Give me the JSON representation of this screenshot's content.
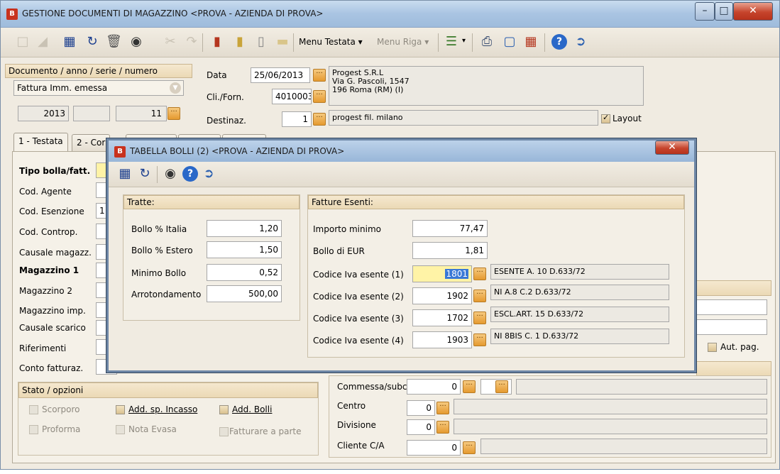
{
  "window": {
    "title": "GESTIONE DOCUMENTI DI MAGAZZINO <PROVA - AZIENDA DI PROVA>",
    "app_icon": "B"
  },
  "menus": {
    "testata": "Menu Testata",
    "riga": "Menu Riga"
  },
  "header": {
    "doc_group_label": "Documento / anno / serie / numero",
    "doc_type": "Fattura Imm. emessa",
    "year": "2013",
    "series": "",
    "number": "11",
    "data_label": "Data",
    "data_value": "25/06/2013",
    "cli_label": "Cli./Forn.",
    "cli_value": "4010003",
    "cli_address_1": "Progest S.R.L",
    "cli_address_2": "Via G. Pascoli, 1547",
    "cli_address_3": "196 Roma (RM)  (I)",
    "dest_label": "Destinaz.",
    "dest_value": "1",
    "dest_desc": "progest fil. milano",
    "layout_label": "Layout"
  },
  "tabs": {
    "tab1": "1 - Testata",
    "tab2": "2 - Cor"
  },
  "left_labels": {
    "tipo_bolla": "Tipo bolla/fatt.",
    "cod_agente": "Cod. Agente",
    "cod_esenzione": "Cod. Esenzione",
    "cod_esenzione_val": "1",
    "cod_controp": "Cod. Controp.",
    "causale_magazz": "Causale magazz.",
    "magazzino1": "Magazzino 1",
    "magazzino2": "Magazzino 2",
    "magazzino_imp": "Magazzino imp.",
    "causale_scarico": "Causale scarico",
    "riferimenti": "Riferimenti",
    "conto_fatturaz": "Conto fatturaz."
  },
  "stato": {
    "header": "Stato / opzioni",
    "scorporo": "Scorporo",
    "add_incasso": "Add. sp. Incasso",
    "add_bolli": "Add. Bolli",
    "proforma": "Proforma",
    "nota_evasa": "Nota Evasa",
    "fatturare_parte": "Fatturare a parte"
  },
  "bottom_right": {
    "aut_pag": "Aut. pag.",
    "commessa_label": "Commessa/subc.",
    "commessa_val": "0",
    "centro_label": "Centro",
    "centro_val": "0",
    "divisione_label": "Divisione",
    "divisione_val": "0",
    "cliente_ca_label": "Cliente C/A",
    "cliente_ca_val": "0"
  },
  "dialog": {
    "title": "TABELLA BOLLI (2) <PROVA - AZIENDA DI PROVA>",
    "tratte": {
      "header": "Tratte:",
      "rows": [
        {
          "label": "Bollo % Italia",
          "value": "1,20"
        },
        {
          "label": "Bollo % Estero",
          "value": "1,50"
        },
        {
          "label": "Minimo Bollo",
          "value": "0,52"
        },
        {
          "label": "Arrotondamento",
          "value": "500,00"
        }
      ]
    },
    "esenti": {
      "header": "Fatture Esenti:",
      "importo_label": "Importo minimo",
      "importo_value": "77,47",
      "bollo_label": "Bollo di EUR",
      "bollo_value": "1,81",
      "codici": [
        {
          "label": "Codice Iva esente (1)",
          "code": "1801",
          "desc": "ESENTE A. 10 D.633/72"
        },
        {
          "label": "Codice Iva esente (2)",
          "code": "1902",
          "desc": "NI A.8 C.2 D.633/72"
        },
        {
          "label": "Codice Iva esente (3)",
          "code": "1702",
          "desc": "ESCL.ART. 15 D.633/72"
        },
        {
          "label": "Codice Iva esente (4)",
          "code": "1903",
          "desc": "NI 8BIS C. 1 D.633/72"
        }
      ]
    }
  },
  "colors": {
    "accent_orange": "#e59a30",
    "title_blue": "#a9c4e2",
    "close_red": "#c6442c",
    "selection_yellow": "#fff3a6"
  }
}
